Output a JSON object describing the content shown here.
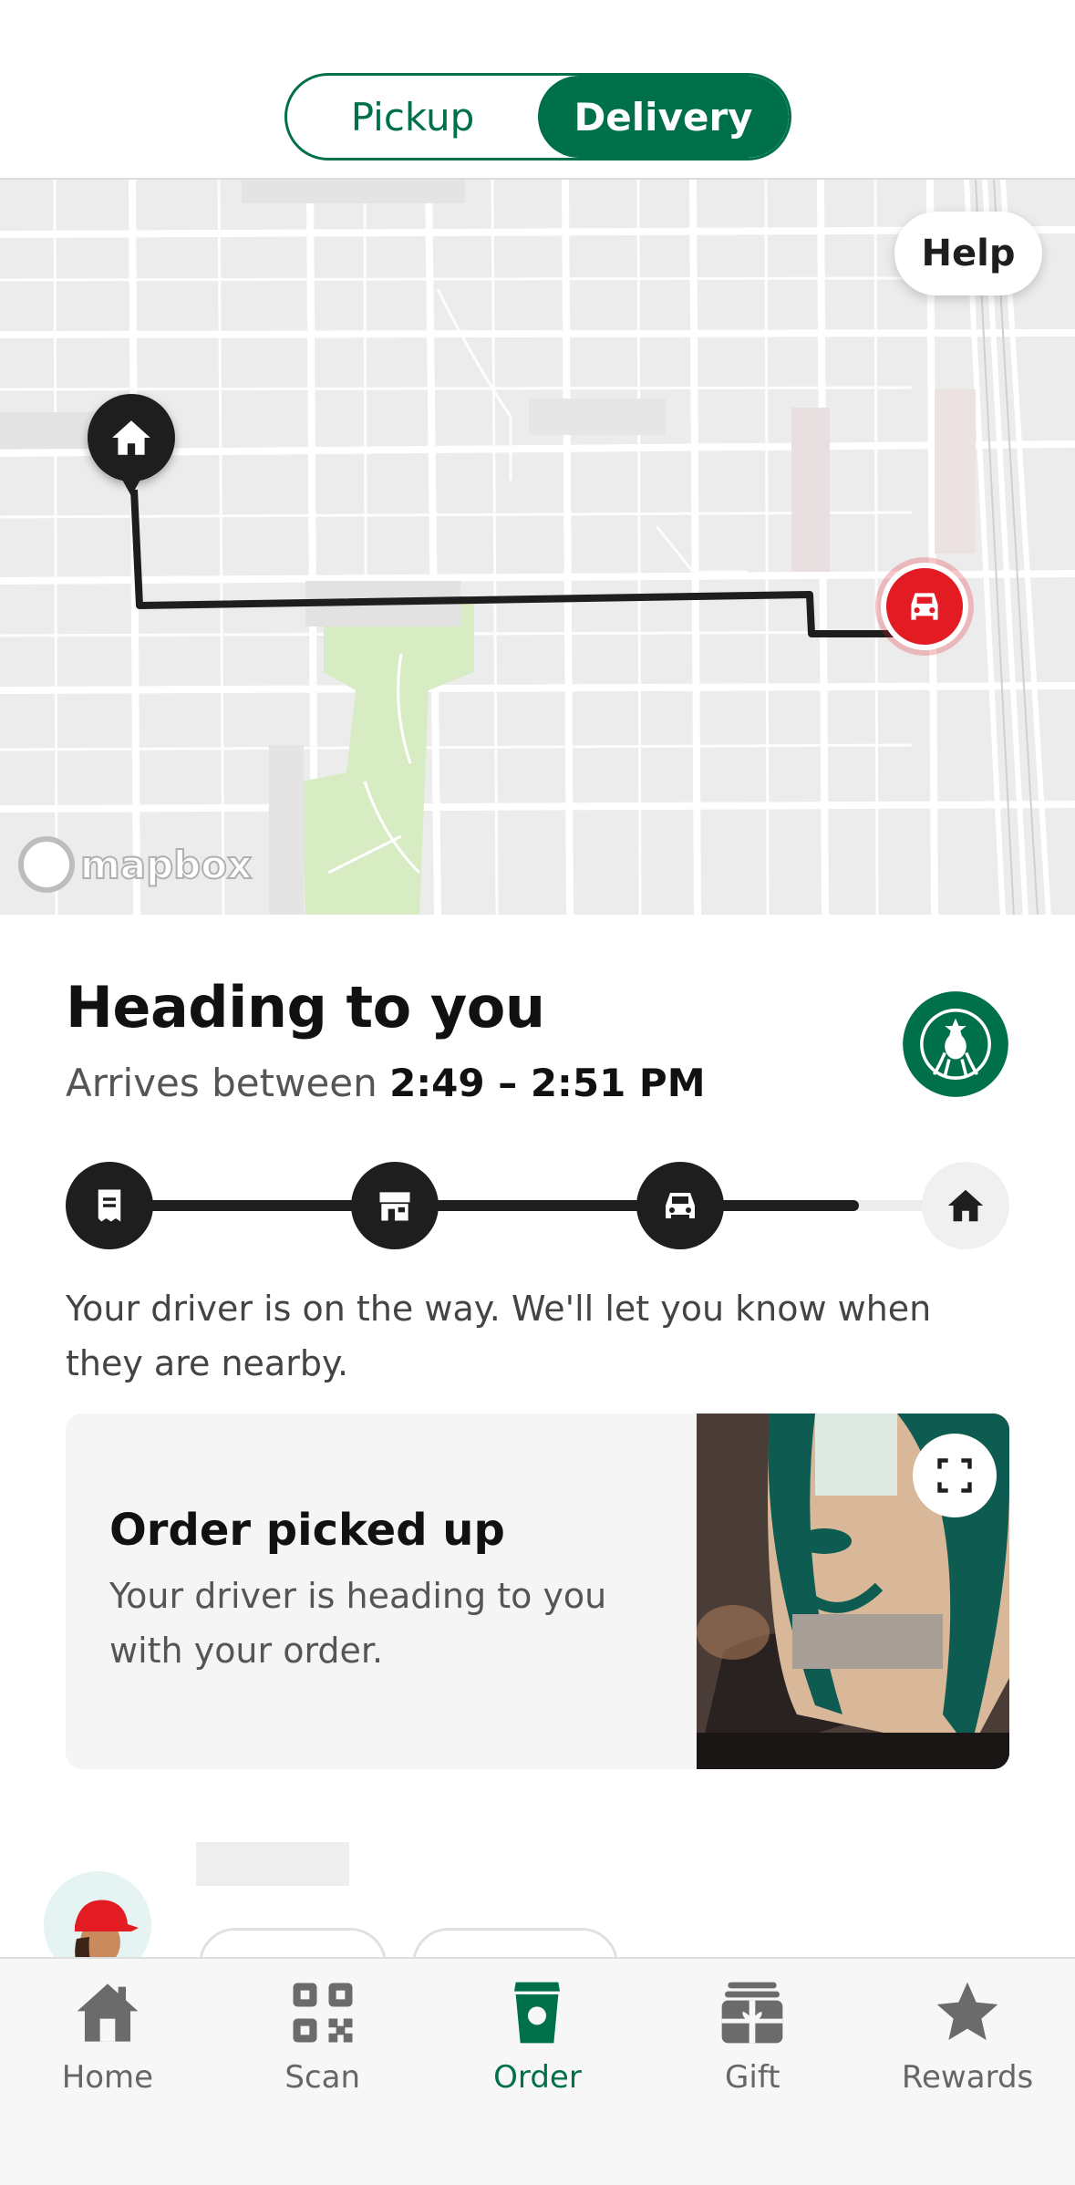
{
  "toggle": {
    "options": [
      {
        "label": "Pickup",
        "active": false
      },
      {
        "label": "Delivery",
        "active": true
      }
    ]
  },
  "map": {
    "help_label": "Help",
    "attribution": "mapbox",
    "home_pin_icon": "home-icon",
    "driver_pin_icon": "car-icon",
    "colors": {
      "route": "#1e1e1e",
      "driver_pin": "#e31b23",
      "park": "#d8ecc4"
    }
  },
  "status": {
    "title": "Heading to you",
    "arrives_prefix": "Arrives between",
    "arrives_window": "2:49 – 2:51 PM",
    "progress_steps": [
      {
        "icon": "receipt-icon",
        "done": true
      },
      {
        "icon": "store-icon",
        "done": true
      },
      {
        "icon": "car-icon",
        "done": true
      },
      {
        "icon": "home-icon",
        "done": false
      }
    ],
    "driver_note": "Your driver is on the way. We'll let you know when they are nearby."
  },
  "pickup_card": {
    "title": "Order picked up",
    "description": "Your driver is heading to you with your order.",
    "expand_icon": "expand-icon"
  },
  "bottom_nav": {
    "items": [
      {
        "label": "Home",
        "icon": "home-icon",
        "active": false
      },
      {
        "label": "Scan",
        "icon": "qr-code-icon",
        "active": false
      },
      {
        "label": "Order",
        "icon": "cup-icon",
        "active": true
      },
      {
        "label": "Gift",
        "icon": "gift-icon",
        "active": false
      },
      {
        "label": "Rewards",
        "icon": "star-icon",
        "active": false
      }
    ]
  },
  "brand_color": "#00704a"
}
